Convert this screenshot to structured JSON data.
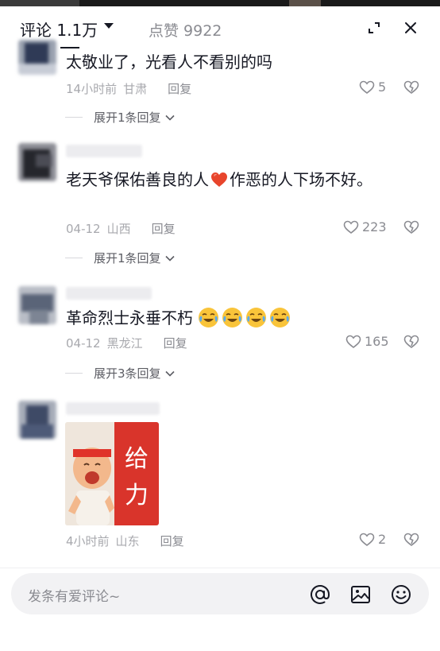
{
  "header": {
    "comment_count": "评论 1.1万",
    "likes_label": "点赞 9922",
    "expand_icon": "expand-icon",
    "close_icon": "close-icon"
  },
  "comments": [
    {
      "text": "太敬业了，光看人不看别的吗",
      "time": "14小时前",
      "location": "甘肃",
      "reply_label": "回复",
      "likes": "5",
      "expand_label": "展开1条回复"
    },
    {
      "text_before": "老天爷保佑善良的人",
      "text_after": "作恶的人下场不好。",
      "time": "04-12",
      "location": "山西",
      "reply_label": "回复",
      "likes": "223",
      "expand_label": "展开1条回复"
    },
    {
      "text": "革命烈士永垂不朽",
      "time": "04-12",
      "location": "黑龙江",
      "reply_label": "回复",
      "likes": "165",
      "expand_label": "展开3条回复"
    },
    {
      "sticker_text": "给力",
      "time": "4小时前",
      "location": "山东",
      "reply_label": "回复",
      "likes": "2"
    }
  ],
  "input": {
    "placeholder": "发条有爱评论~",
    "icons": [
      "at-icon",
      "image-icon",
      "emoji-icon"
    ]
  },
  "colors": {
    "primary_text": "#161823",
    "secondary_text": "#8a8b91",
    "heart_emoji": "#e8452c",
    "sticker_red": "#d9342b"
  }
}
